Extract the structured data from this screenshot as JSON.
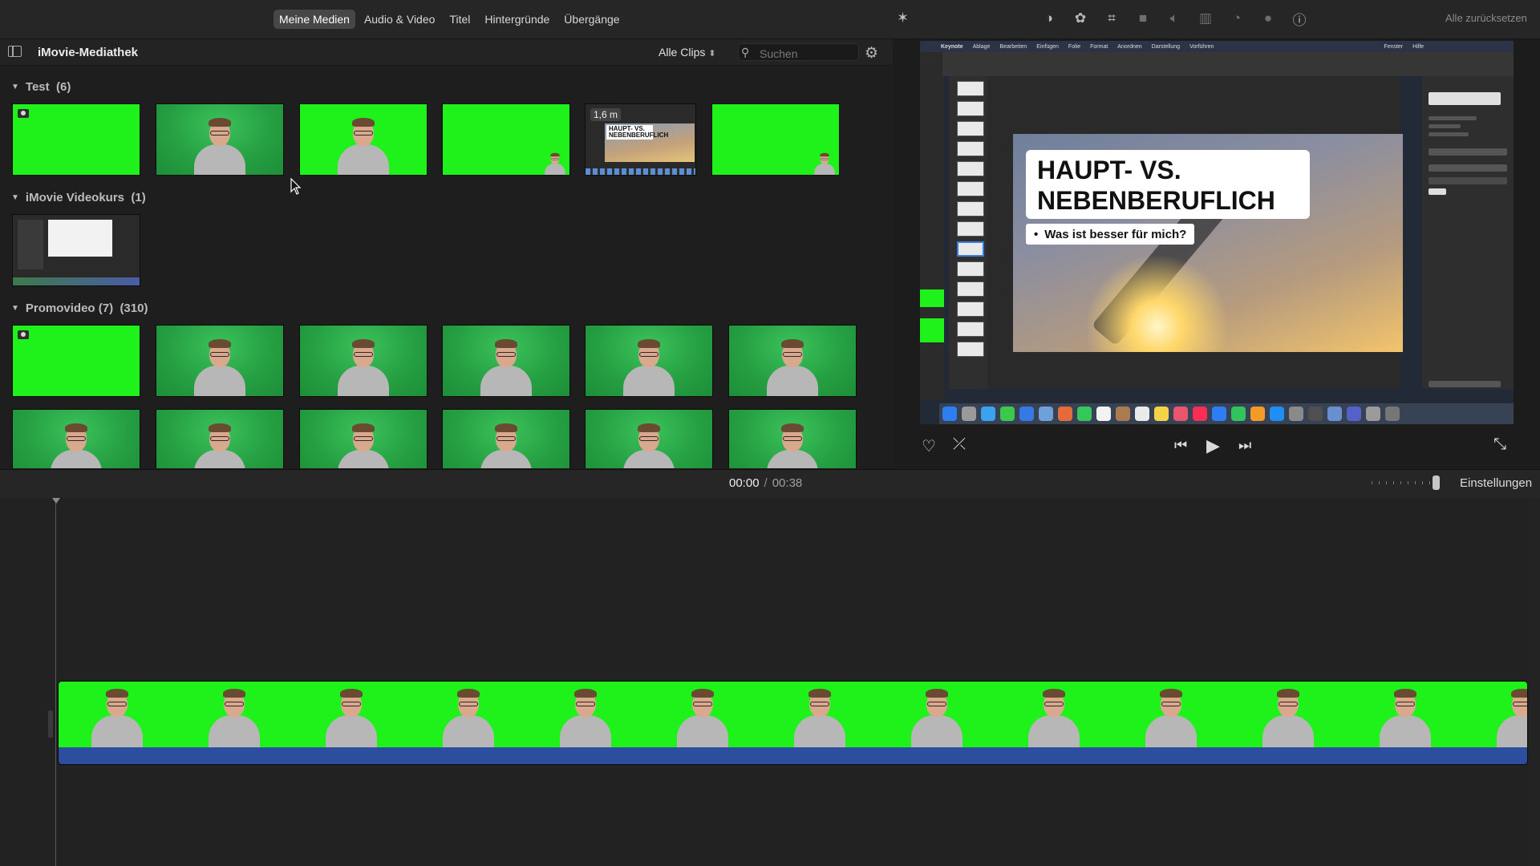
{
  "top_bar": {
    "tabs": [
      {
        "label": "Meine Medien",
        "active": true
      },
      {
        "label": "Audio & Video",
        "active": false
      },
      {
        "label": "Titel",
        "active": false
      },
      {
        "label": "Hintergründe",
        "active": false
      },
      {
        "label": "Übergänge",
        "active": false
      }
    ],
    "tools": [
      "color-balance-icon",
      "color-correction-icon",
      "crop-icon",
      "stabilization-icon",
      "volume-icon",
      "equalizer-icon",
      "speed-icon",
      "clip-filter-icon",
      "info-icon"
    ],
    "reset_label": "Alle zurücksetzen"
  },
  "library": {
    "title": "iMovie-Mediathek",
    "filter_label": "Alle Clips",
    "search_placeholder": "Suchen",
    "sections": [
      {
        "name": "Test",
        "count": "(6)"
      },
      {
        "name": "iMovie Videokurs",
        "count": "(1)"
      },
      {
        "name": "Promovideo (7)",
        "count": "(310)"
      }
    ],
    "test_screen_duration": "1,6 m"
  },
  "viewer": {
    "keynote_menu": [
      "Keynote",
      "Ablage",
      "Bearbeiten",
      "Einfügen",
      "Folie",
      "Format",
      "Anordnen",
      "Darstellung",
      "Vorführen",
      "Fenster",
      "Hilfe"
    ],
    "slide_title": "HAUPT- VS. NEBENBERUFLICH",
    "slide_subtitle": "Was ist besser für mich?",
    "mini_title": "HAUPT- VS. NEBENBERUFLICH"
  },
  "timecode": {
    "current": "00:00",
    "separator": "/",
    "total": "00:38"
  },
  "timeline": {
    "settings_label": "Einstellungen"
  },
  "colors": {
    "green_screen": "#1ff21a",
    "audio_track": "#2d4e9e",
    "background": "#1e1e1e"
  }
}
